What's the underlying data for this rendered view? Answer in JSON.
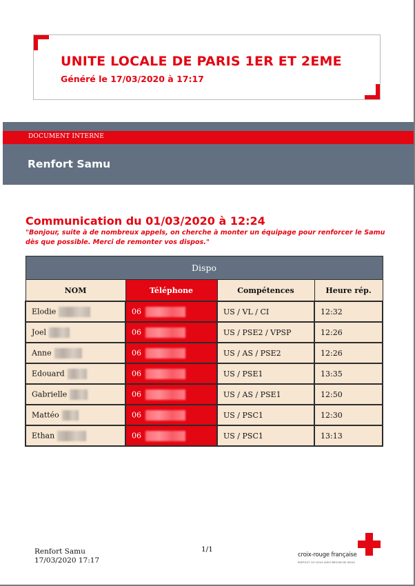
{
  "header": {
    "title": "UNITE LOCALE DE PARIS 1ER ET 2EME",
    "generated": "Généré le 17/03/2020 à 17:17"
  },
  "banner": {
    "label": "DOCUMENT INTERNE",
    "title": "Renfort Samu"
  },
  "communication": {
    "title": "Communication du 01/03/2020 à 12:24",
    "message": "\"Bonjour, suite à de nombreux appels, on cherche à monter un équipage pour renforcer le Samu dès que possible. Merci de remonter vos dispos.\""
  },
  "table": {
    "caption": "Dispo",
    "columns": [
      "NOM",
      "Téléphone",
      "Compétences",
      "Heure rép."
    ],
    "rows": [
      {
        "name": "Elodie",
        "phone": "06",
        "skills": "US / VL / CI",
        "time": "12:32"
      },
      {
        "name": "Joel",
        "phone": "06",
        "skills": "US / PSE2 / VPSP",
        "time": "12:26"
      },
      {
        "name": "Anne",
        "phone": "06",
        "skills": "US / AS / PSE2",
        "time": "12:26"
      },
      {
        "name": "Edouard",
        "phone": "06",
        "skills": "US / PSE1",
        "time": "13:35"
      },
      {
        "name": "Gabrielle",
        "phone": "06",
        "skills": "US / AS / PSE1",
        "time": "12:50"
      },
      {
        "name": "Mattéo",
        "phone": "06",
        "skills": "US / PSC1",
        "time": "12:30"
      },
      {
        "name": "Ethan",
        "phone": "06",
        "skills": "US / PSC1",
        "time": "13:13"
      }
    ]
  },
  "footer": {
    "doc_title": "Renfort Samu",
    "datetime": "17/03/2020 17:17",
    "page": "1/1",
    "logo_name": "croix-rouge française",
    "logo_tagline": "PARTOUT OÙ VOUS AVEZ BESOIN DE NOUS"
  },
  "colors": {
    "brand_red": "#e30613",
    "band_slate": "#627081",
    "cell_beige": "#f6e6d2"
  }
}
